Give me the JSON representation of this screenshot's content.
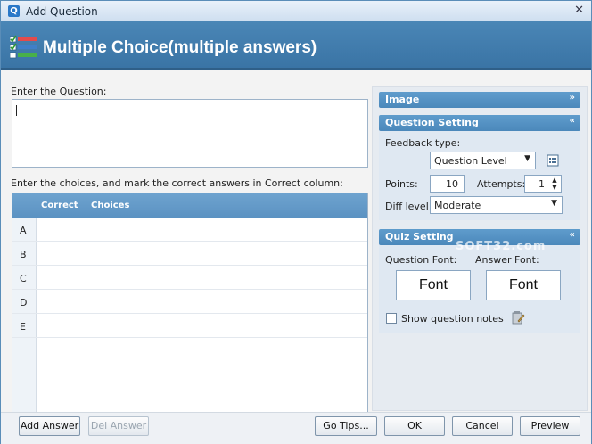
{
  "window": {
    "title": "Add Question",
    "close_glyph": "✕",
    "app_icon": "Q"
  },
  "banner": {
    "title": "Multiple Choice(multiple answers)",
    "icon": "checklist-icon"
  },
  "question": {
    "label": "Enter the Question:",
    "value": ""
  },
  "choices": {
    "label": "Enter the choices, and mark the correct answers in Correct column:",
    "headers": [
      "Correct",
      "Choices"
    ],
    "rows": [
      "A",
      "B",
      "C",
      "D",
      "E"
    ]
  },
  "image_section": {
    "title": "Image",
    "chevron": "»"
  },
  "question_setting": {
    "title": "Question Setting",
    "chevron": "«",
    "feedback_label": "Feedback type:",
    "feedback_value": "Question Level",
    "points_label": "Points:",
    "points_value": "10",
    "attempts_label": "Attempts:",
    "attempts_value": "1",
    "diff_label": "Diff level:",
    "diff_value": "Moderate"
  },
  "quiz_setting": {
    "title": "Quiz Setting",
    "chevron": "«",
    "question_font_label": "Question Font:",
    "answer_font_label": "Answer Font:",
    "question_font_button": "Font",
    "answer_font_button": "Font",
    "show_notes_label": "Show question notes",
    "show_notes_checked": false
  },
  "buttons": {
    "add_answer": "Add Answer",
    "del_answer": "Del Answer",
    "go_tips": "Go Tips...",
    "ok": "OK",
    "cancel": "Cancel",
    "preview": "Preview"
  },
  "watermark": "SOFT32.com",
  "colors": {
    "banner": "#4a86b6",
    "section_header": "#5f9ccc",
    "accent": "#2a78c8"
  }
}
